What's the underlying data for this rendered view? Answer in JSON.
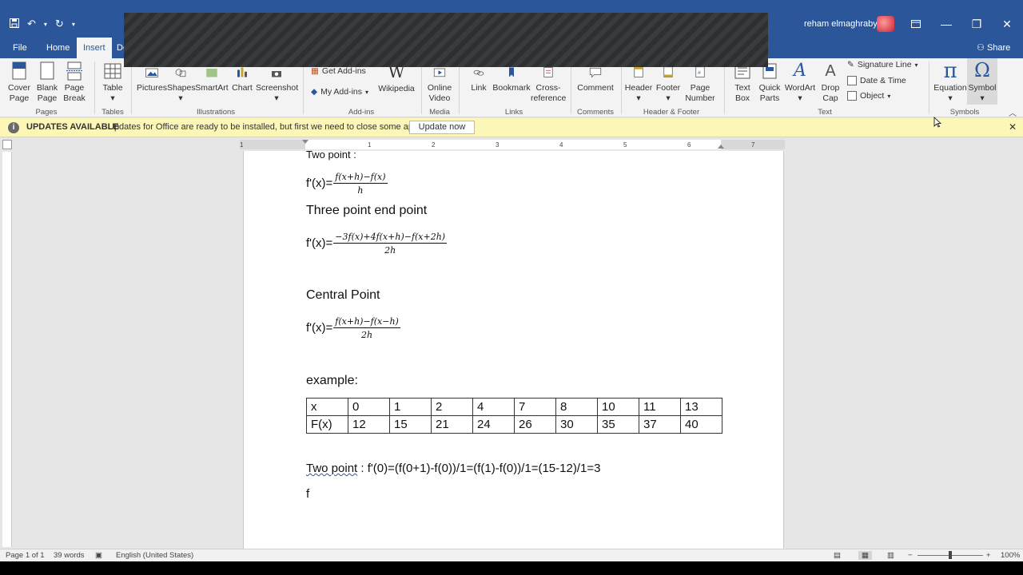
{
  "window": {
    "user_name": "reham elmaghraby",
    "controls": {
      "minimize": "—",
      "restore": "❐",
      "close": "✕"
    }
  },
  "tabs": [
    {
      "label": "File"
    },
    {
      "label": "Home"
    },
    {
      "label": "Insert"
    },
    {
      "label": "De"
    }
  ],
  "share_label": "Share",
  "ribbon": {
    "pages": {
      "cover_page": "Cover",
      "cover_page_2": "Page",
      "blank_page": "Blank",
      "blank_page_2": "Page",
      "page_break": "Page",
      "page_break_2": "Break",
      "group": "Pages"
    },
    "tables": {
      "table": "Table",
      "group": "Tables"
    },
    "illustrations": {
      "pictures": "Pictures",
      "shapes": "Shapes",
      "smartart": "SmartArt",
      "chart": "Chart",
      "screenshot": "Screenshot",
      "group": "Illustrations"
    },
    "addins": {
      "get_addins": "Get Add-ins",
      "my_addins": "My Add-ins",
      "wikipedia": "Wikipedia",
      "group": "Add-ins"
    },
    "media": {
      "online_video": "Online",
      "online_video_2": "Video",
      "group": "Media"
    },
    "links": {
      "link": "Link",
      "bookmark": "Bookmark",
      "cross_ref": "Cross-",
      "cross_ref_2": "reference",
      "group": "Links"
    },
    "comments": {
      "comment": "Comment",
      "group": "Comments"
    },
    "header_footer": {
      "header": "Header",
      "footer": "Footer",
      "page_number": "Page",
      "page_number_2": "Number",
      "group": "Header & Footer"
    },
    "text": {
      "text_box": "Text",
      "text_box_2": "Box",
      "quick_parts": "Quick",
      "quick_parts_2": "Parts",
      "wordart": "WordArt",
      "drop_cap": "Drop",
      "drop_cap_2": "Cap",
      "signature_line": "Signature Line",
      "date_time": "Date & Time",
      "object": "Object",
      "group": "Text"
    },
    "symbols": {
      "equation": "Equation",
      "symbol": "Symbol",
      "group": "Symbols"
    }
  },
  "message_bar": {
    "title": "UPDATES AVAILABLE",
    "text": "Updates for Office are ready to be installed, but first we need to close some apps.",
    "button": "Update now"
  },
  "ruler": {
    "ticks": [
      "1",
      "1",
      "2",
      "3",
      "4",
      "5",
      "6",
      "7"
    ]
  },
  "document": {
    "two_point_heading": "Two point :",
    "fx": "f'(x)=",
    "f1_num": "f(x+h)−f(x)",
    "f1_den": "h",
    "three_point_heading": "Three point end point",
    "f2_num": "−3f(x)+4f(x+h)−f(x+2h)",
    "f2_den": "2h",
    "central_heading": "Central Point",
    "f3_num": "f(x+h)−f(x−h)",
    "f3_den": "2h",
    "example": "example:",
    "table": {
      "rows": [
        [
          "x",
          "0",
          "1",
          "2",
          "4",
          "7",
          "8",
          "10",
          "11",
          "13"
        ],
        [
          "F(x)",
          "12",
          "15",
          "21",
          "24",
          "26",
          "30",
          "35",
          "37",
          "40"
        ]
      ]
    },
    "two_point_word": "Two point",
    "two_point_calc": " : f'(0)=(f(0+1)-f(0))/1=(f(1)-f(0))/1=(15-12)/1=3",
    "last_line": "f"
  },
  "status": {
    "page": "Page 1 of 1",
    "words": "39 words",
    "language": "English (United States)",
    "zoom": "100%"
  },
  "colors": {
    "word_blue": "#2b579a",
    "message_yellow": "#fcf7b6"
  }
}
